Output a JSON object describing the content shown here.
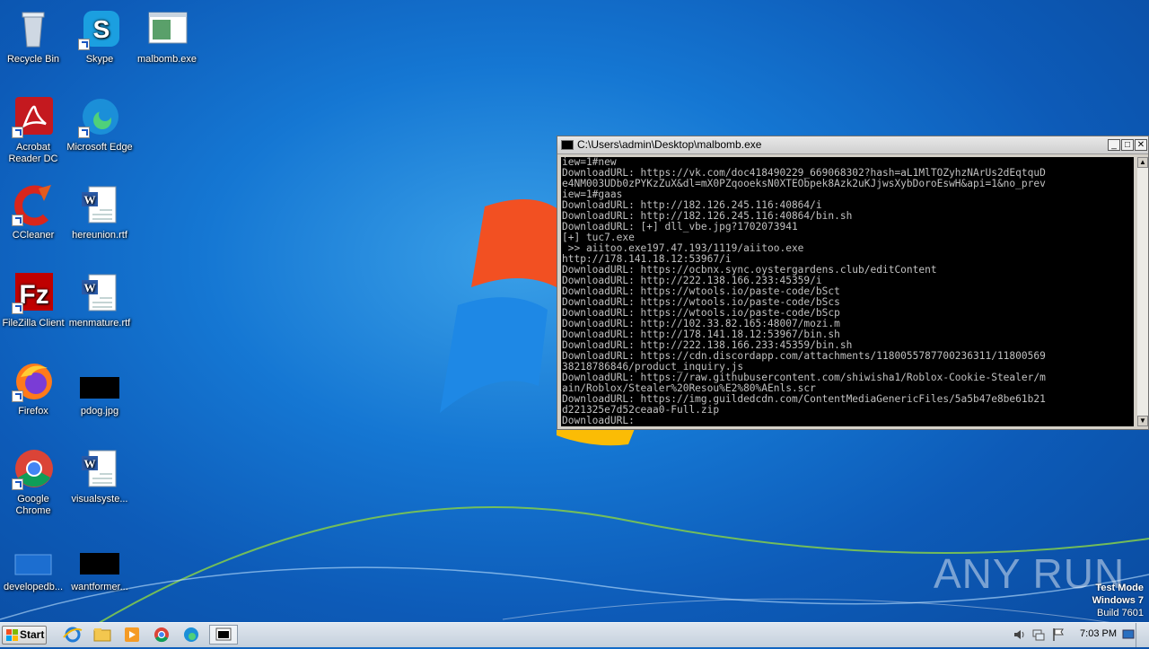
{
  "desktop_icons": [
    {
      "name": "recycle-bin-icon",
      "label": "Recycle Bin"
    },
    {
      "name": "skype-icon",
      "label": "Skype"
    },
    {
      "name": "malbomb-exe-icon",
      "label": "malbomb.exe"
    },
    {
      "name": "acrobat-reader-icon",
      "label": "Acrobat Reader DC"
    },
    {
      "name": "microsoft-edge-icon",
      "label": "Microsoft Edge"
    },
    {
      "name": "ccleaner-icon",
      "label": "CCleaner"
    },
    {
      "name": "hereunion-rtf-icon",
      "label": "hereunion.rtf"
    },
    {
      "name": "filezilla-icon",
      "label": "FileZilla Client"
    },
    {
      "name": "menmature-rtf-icon",
      "label": "menmature.rtf"
    },
    {
      "name": "firefox-icon",
      "label": "Firefox"
    },
    {
      "name": "pdog-jpg-icon",
      "label": "pdog.jpg"
    },
    {
      "name": "google-chrome-icon",
      "label": "Google Chrome"
    },
    {
      "name": "visualsystem-icon",
      "label": "visualsyste..."
    },
    {
      "name": "developedb-icon",
      "label": "developedb..."
    },
    {
      "name": "wantformer-icon",
      "label": "wantformer..."
    }
  ],
  "console": {
    "title": "C:\\Users\\admin\\Desktop\\malbomb.exe",
    "lines": [
      "iew=1#new",
      "DownloadURL: https://vk.com/doc418490229_669068302?hash=aL1MlTOZyhzNArUs2dEqtquD",
      "e4NM003UDb0zPYKzZuX&dl=mX0PZqooeksN0XTEObpek8Azk2uKJjwsXybDoroEswH&api=1&no_prev",
      "iew=1#gaas",
      "DownloadURL: http://182.126.245.116:40864/i",
      "DownloadURL: http://182.126.245.116:40864/bin.sh",
      "DownloadURL: [+] dll_vbe.jpg?1702073941",
      "[+] tuc7.exe",
      " >> aiitoo.exe197.47.193/1119/aiitoo.exe",
      "http://178.141.18.12:53967/i",
      "DownloadURL: https://ocbnx.sync.oystergardens.club/editContent",
      "DownloadURL: http://222.138.166.233:45359/i",
      "DownloadURL: https://wtools.io/paste-code/bSct",
      "DownloadURL: https://wtools.io/paste-code/bScs",
      "DownloadURL: https://wtools.io/paste-code/bScp",
      "DownloadURL: http://102.33.82.165:48007/mozi.m",
      "DownloadURL: http://178.141.18.12:53967/bin.sh",
      "DownloadURL: http://222.138.166.233:45359/bin.sh",
      "DownloadURL: https://cdn.discordapp.com/attachments/1180055787700236311/11800569",
      "38218786846/product_inquiry.js",
      "DownloadURL: https://raw.githubusercontent.com/shiwisha1/Roblox-Cookie-Stealer/m",
      "ain/Roblox/Stealer%20Resou%E2%80%AEnls.scr",
      "DownloadURL: https://img.guildedcdn.com/ContentMediaGenericFiles/5a5b47e8be61b21",
      "d221325e7d52ceaa0-Full.zip",
      "DownloadURL: "
    ]
  },
  "watermark": {
    "text": "ANY RUN"
  },
  "test_mode": {
    "line1": "Test Mode",
    "line2": "Windows 7",
    "line3": "Build 7601"
  },
  "taskbar": {
    "start_label": "Start",
    "clock": "7:03 PM",
    "apps": [
      "internet-explorer-icon",
      "file-explorer-icon",
      "media-player-icon",
      "chrome-icon",
      "edge-icon",
      "console-icon"
    ]
  },
  "colors": {
    "desktop": "#1577d3",
    "console_bg": "#000000",
    "console_text": "#c0c0c0"
  }
}
